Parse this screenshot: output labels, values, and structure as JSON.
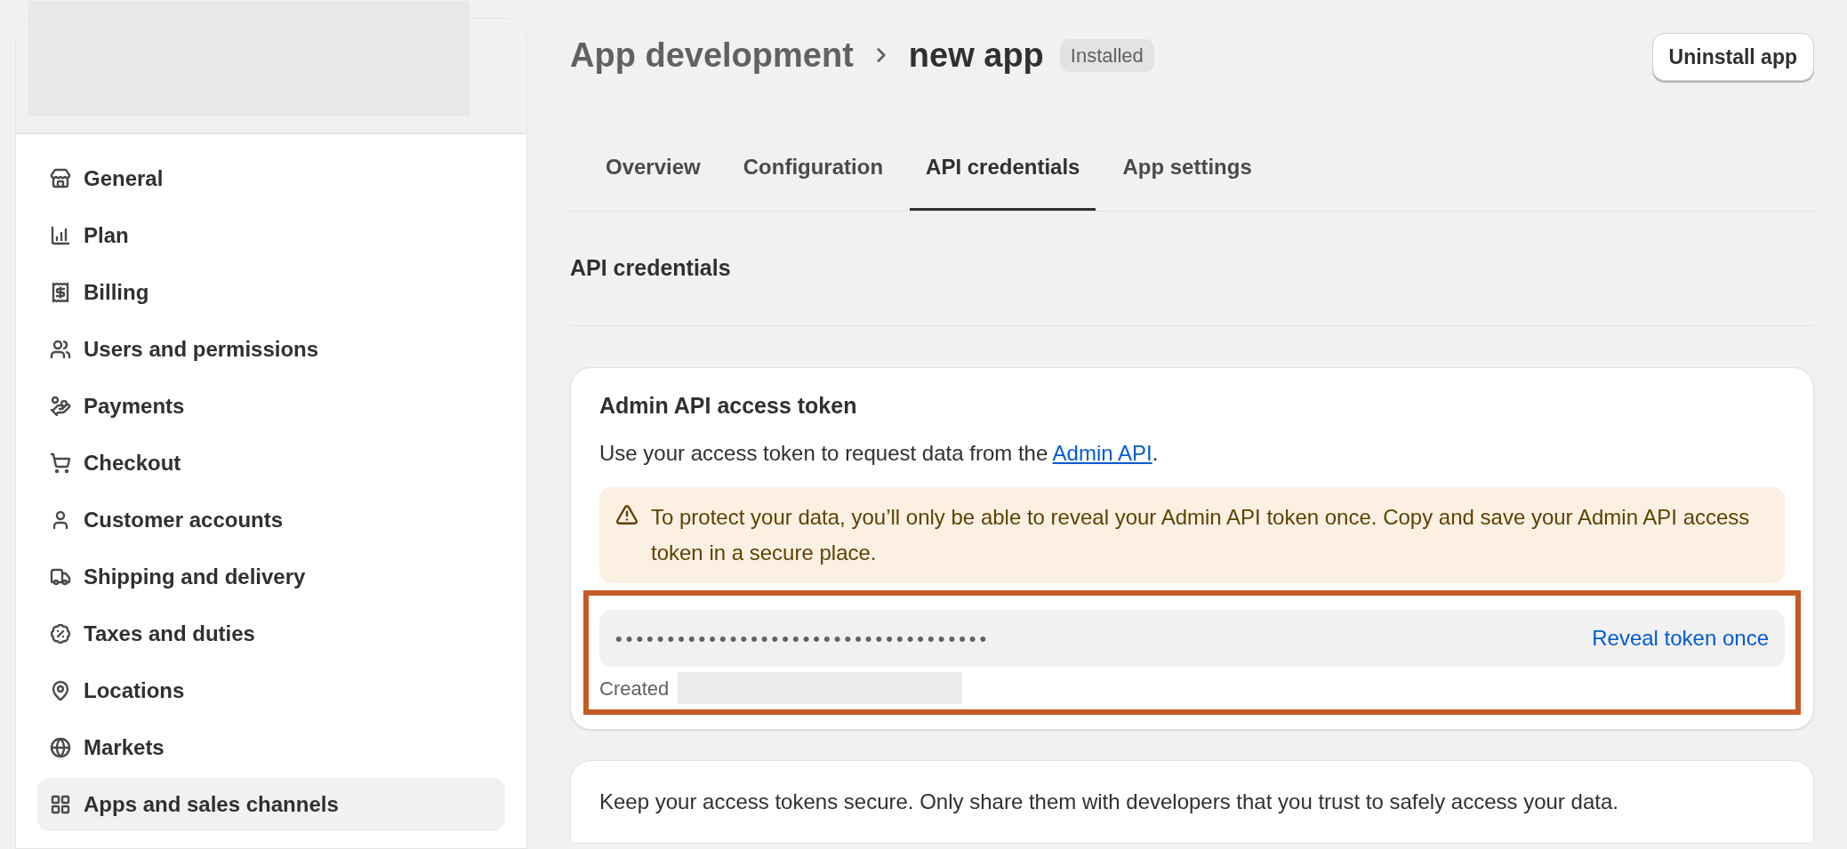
{
  "sidebar": {
    "items": [
      {
        "label": "General",
        "selected": false
      },
      {
        "label": "Plan",
        "selected": false
      },
      {
        "label": "Billing",
        "selected": false
      },
      {
        "label": "Users and permissions",
        "selected": false
      },
      {
        "label": "Payments",
        "selected": false
      },
      {
        "label": "Checkout",
        "selected": false
      },
      {
        "label": "Customer accounts",
        "selected": false
      },
      {
        "label": "Shipping and delivery",
        "selected": false
      },
      {
        "label": "Taxes and duties",
        "selected": false
      },
      {
        "label": "Locations",
        "selected": false
      },
      {
        "label": "Markets",
        "selected": false
      },
      {
        "label": "Apps and sales channels",
        "selected": true
      }
    ]
  },
  "header": {
    "breadcrumb": "App development",
    "title": "new app",
    "badge": "Installed",
    "button": "Uninstall app"
  },
  "tabs": [
    {
      "label": "Overview",
      "selected": false
    },
    {
      "label": "Configuration",
      "selected": false
    },
    {
      "label": "API credentials",
      "selected": true
    },
    {
      "label": "App settings",
      "selected": false
    }
  ],
  "section_title": "API credentials",
  "token_card": {
    "title": "Admin API access token",
    "description": "Use your access token to request data from the",
    "link": "Admin API",
    "description_end": ".",
    "warning": "To protect your data, you’ll only be able to reveal your Admin API token once. Copy and save your Admin API access token in a secure place.",
    "token": {
      "value": "••••••••••••••••••••••••••••••••••••",
      "action": "Reveal token once"
    },
    "created_label": "Created"
  },
  "security_card": {
    "text": "Keep your access tokens secure. Only share them with developers that you trust to safely access your data."
  }
}
